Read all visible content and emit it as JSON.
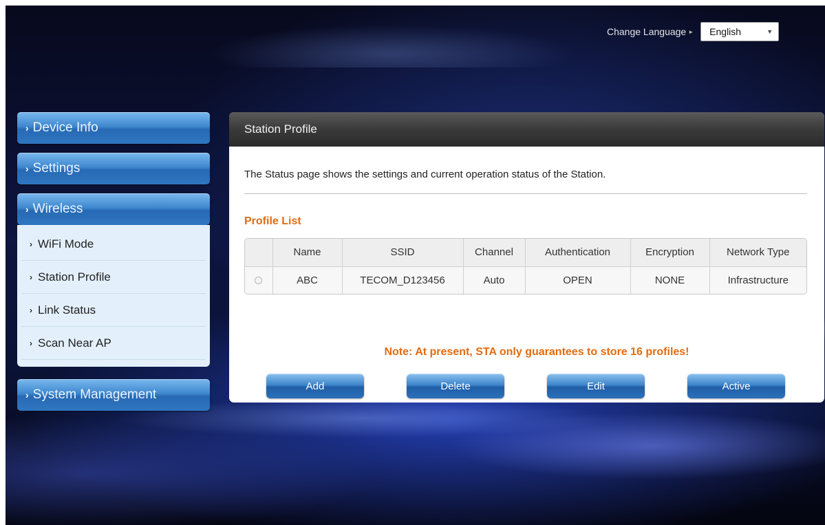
{
  "header": {
    "language_label": "Change Language",
    "language_arrow": "►",
    "language_selected": "English",
    "language_caret": "▼"
  },
  "sidebar": {
    "chevron": "›",
    "items": [
      {
        "label": "Device Info"
      },
      {
        "label": "Settings"
      },
      {
        "label": "Wireless"
      },
      {
        "label": "System Management"
      }
    ],
    "wireless_submenu": [
      {
        "label": "WiFi Mode"
      },
      {
        "label": "Station Profile"
      },
      {
        "label": "Link Status"
      },
      {
        "label": "Scan Near AP"
      }
    ]
  },
  "main": {
    "title": "Station Profile",
    "description": "The Status page shows the settings and current operation status of the Station.",
    "section_title": "Profile List",
    "table": {
      "headers": [
        "",
        "Name",
        "SSID",
        "Channel",
        "Authentication",
        "Encryption",
        "Network Type"
      ],
      "rows": [
        {
          "name": "ABC",
          "ssid": "TECOM_D123456",
          "channel": "Auto",
          "authentication": "OPEN",
          "encryption": "NONE",
          "network_type": "Infrastructure"
        }
      ]
    },
    "note": "Note: At present, STA only guarantees to store 16 profiles!",
    "buttons": {
      "add": "Add",
      "delete": "Delete",
      "edit": "Edit",
      "active": "Active"
    }
  },
  "colors": {
    "accent_orange": "#e36b10",
    "menu_blue": "#3f88cf",
    "panel_header": "#3a3a3a"
  }
}
